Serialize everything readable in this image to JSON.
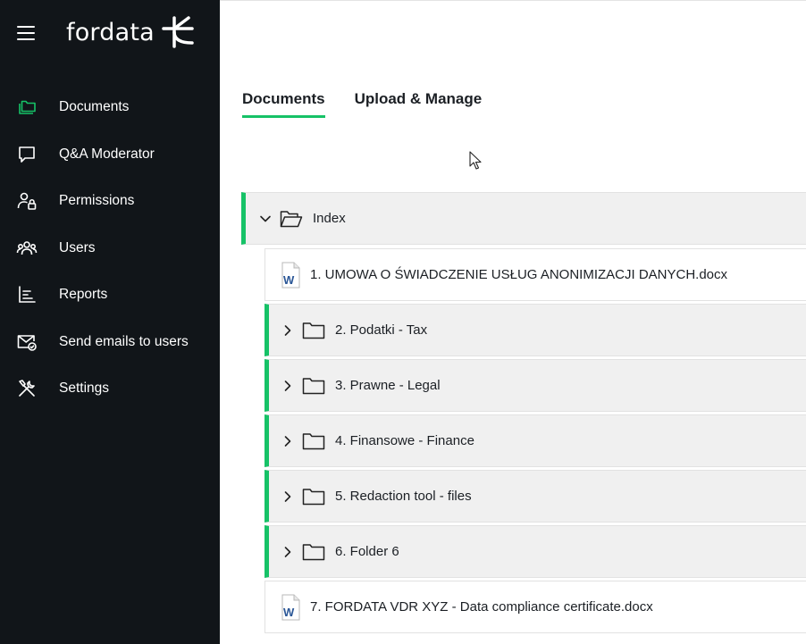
{
  "app": {
    "logo_text": "fordata",
    "brand_color": "#16c267",
    "sidebar_bg": "#111519"
  },
  "sidebar": {
    "items": [
      {
        "label": "Documents",
        "icon": "folders-icon",
        "active": true
      },
      {
        "label": "Q&A Moderator",
        "icon": "chat-bubble-icon"
      },
      {
        "label": "Permissions",
        "icon": "user-lock-icon"
      },
      {
        "label": "Users",
        "icon": "users-icon"
      },
      {
        "label": "Reports",
        "icon": "bar-chart-icon"
      },
      {
        "label": "Send emails to users",
        "icon": "envelope-check-icon"
      },
      {
        "label": "Settings",
        "icon": "tools-icon"
      }
    ]
  },
  "tabs": [
    {
      "label": "Documents",
      "active": true
    },
    {
      "label": "Upload & Manage",
      "active": false
    }
  ],
  "tree": {
    "root": {
      "label": "Index",
      "expanded": true
    },
    "children": [
      {
        "type": "file",
        "label": "1. UMOWA O ŚWIADCZENIE USŁUG ANONIMIZACJI DANYCH.docx"
      },
      {
        "type": "folder",
        "label": "2. Podatki - Tax"
      },
      {
        "type": "folder",
        "label": "3. Prawne - Legal"
      },
      {
        "type": "folder",
        "label": "4. Finansowe - Finance"
      },
      {
        "type": "folder",
        "label": "5. Redaction tool - files"
      },
      {
        "type": "folder",
        "label": "6. Folder 6"
      },
      {
        "type": "file",
        "label": "7. FORDATA VDR XYZ - Data compliance certificate.docx"
      }
    ]
  }
}
